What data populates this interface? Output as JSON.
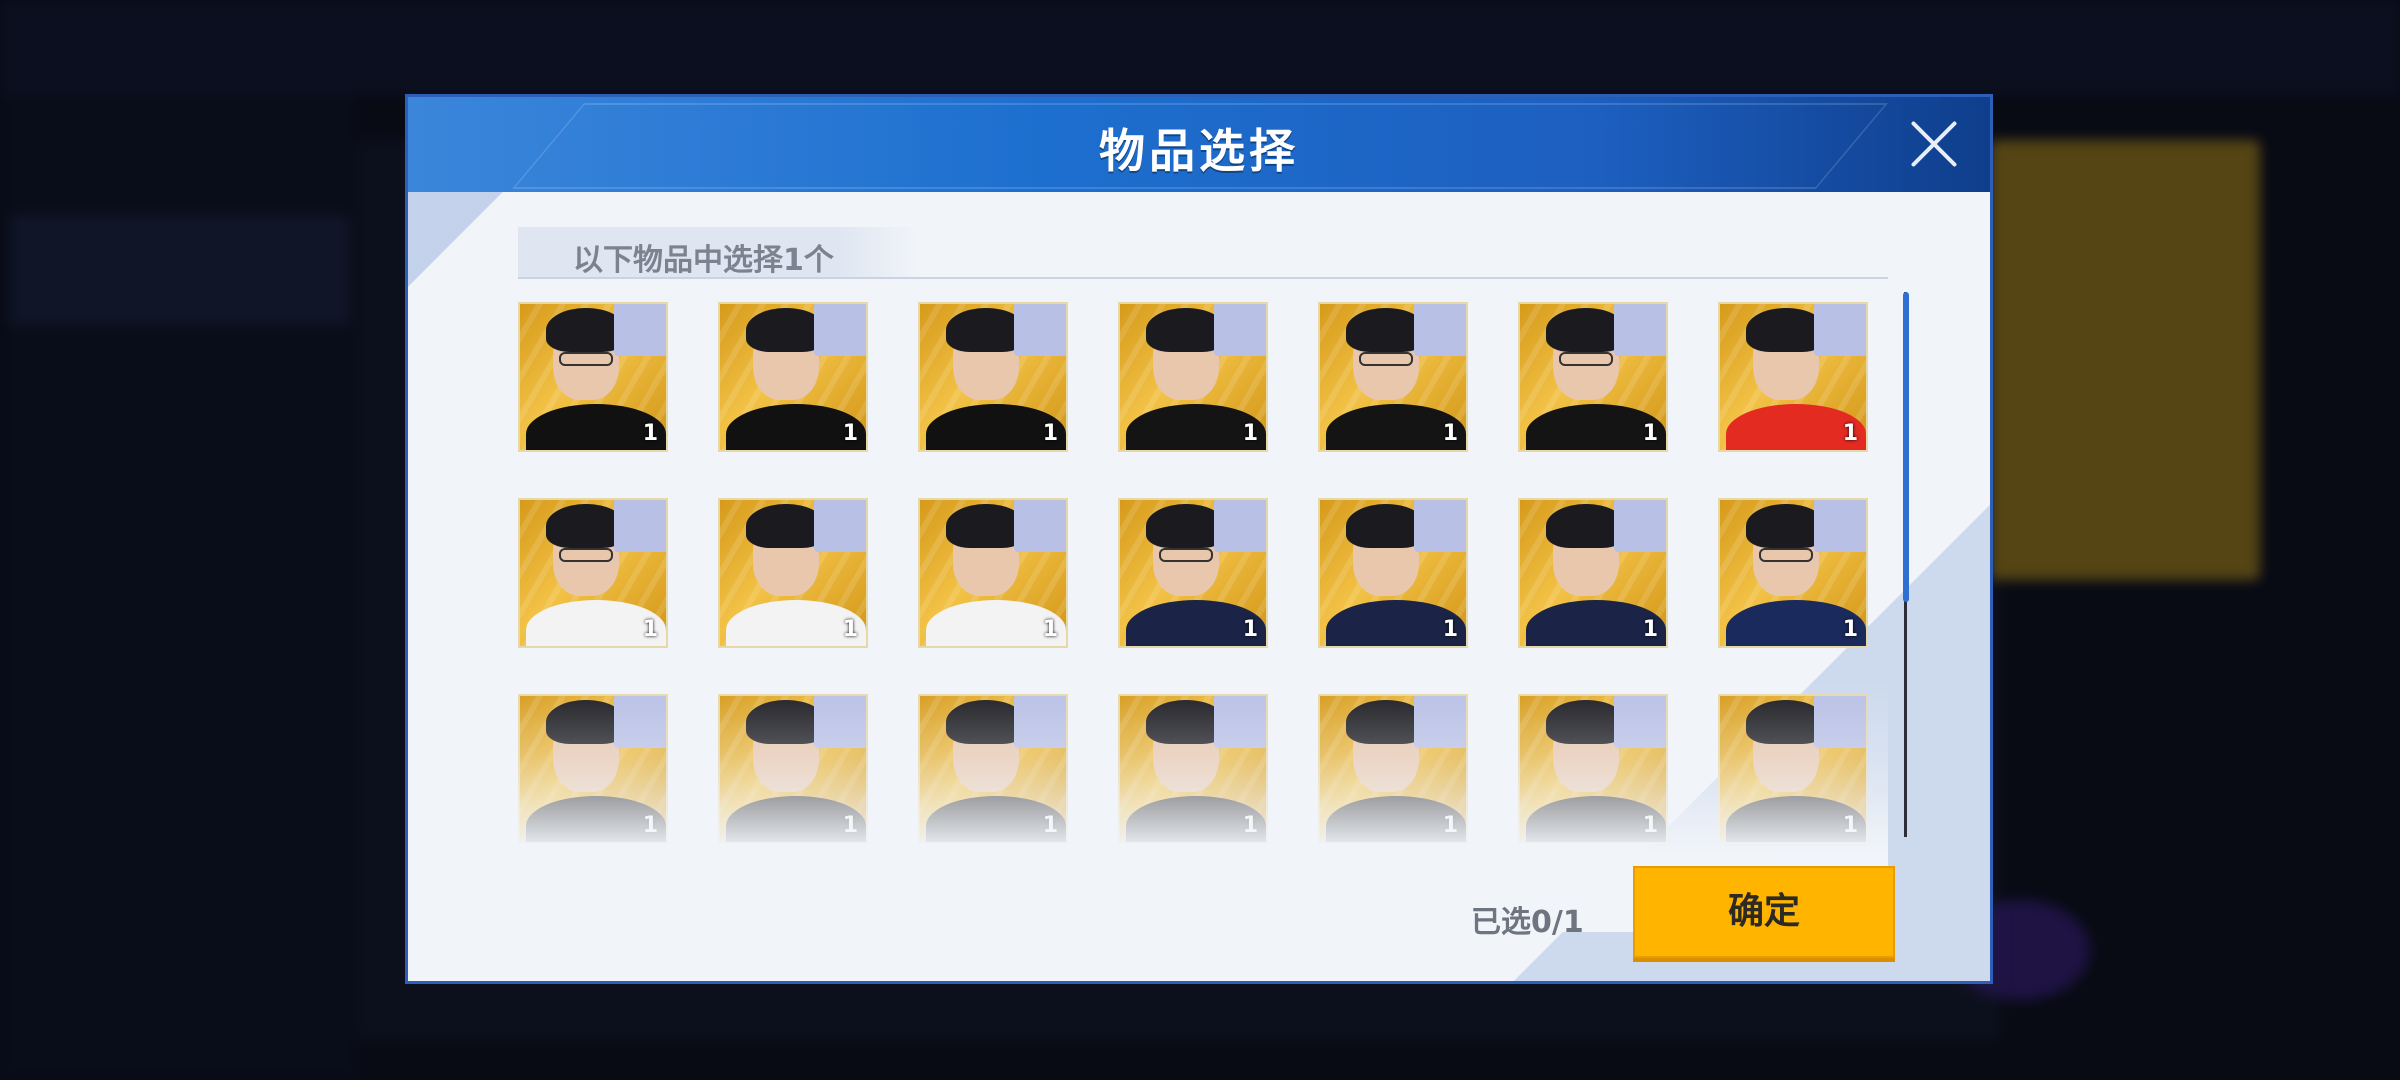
{
  "dialog": {
    "title": "物品选择",
    "subtitle": "以下物品中选择1个",
    "selected_count": "已选0/1",
    "confirm_label": "确定"
  },
  "items": [
    {
      "count": "1",
      "jersey": "#111111",
      "glasses": true
    },
    {
      "count": "1",
      "jersey": "#111111",
      "glasses": false
    },
    {
      "count": "1",
      "jersey": "#111111",
      "glasses": false
    },
    {
      "count": "1",
      "jersey": "#141414",
      "glasses": false
    },
    {
      "count": "1",
      "jersey": "#141414",
      "glasses": true
    },
    {
      "count": "1",
      "jersey": "#141414",
      "glasses": true
    },
    {
      "count": "1",
      "jersey": "#e32b22",
      "glasses": false
    },
    {
      "count": "1",
      "jersey": "#f3f3f3",
      "glasses": true
    },
    {
      "count": "1",
      "jersey": "#f3f3f3",
      "glasses": false
    },
    {
      "count": "1",
      "jersey": "#f3f3f3",
      "glasses": false
    },
    {
      "count": "1",
      "jersey": "#1b2446",
      "glasses": true
    },
    {
      "count": "1",
      "jersey": "#1b2446",
      "glasses": false
    },
    {
      "count": "1",
      "jersey": "#1b2446",
      "glasses": false
    },
    {
      "count": "1",
      "jersey": "#1b2a5c",
      "glasses": true
    },
    {
      "count": "1",
      "jersey": "#222222",
      "glasses": false
    },
    {
      "count": "1",
      "jersey": "#222222",
      "glasses": false
    },
    {
      "count": "1",
      "jersey": "#222222",
      "glasses": false
    },
    {
      "count": "1",
      "jersey": "#222222",
      "glasses": false
    },
    {
      "count": "1",
      "jersey": "#222222",
      "glasses": false
    },
    {
      "count": "1",
      "jersey": "#222222",
      "glasses": false
    },
    {
      "count": "1",
      "jersey": "#222222",
      "glasses": false
    }
  ],
  "colors": {
    "header": "#1d6fcf",
    "confirm": "#ffb400",
    "checkbox": "#b8c0e6"
  }
}
